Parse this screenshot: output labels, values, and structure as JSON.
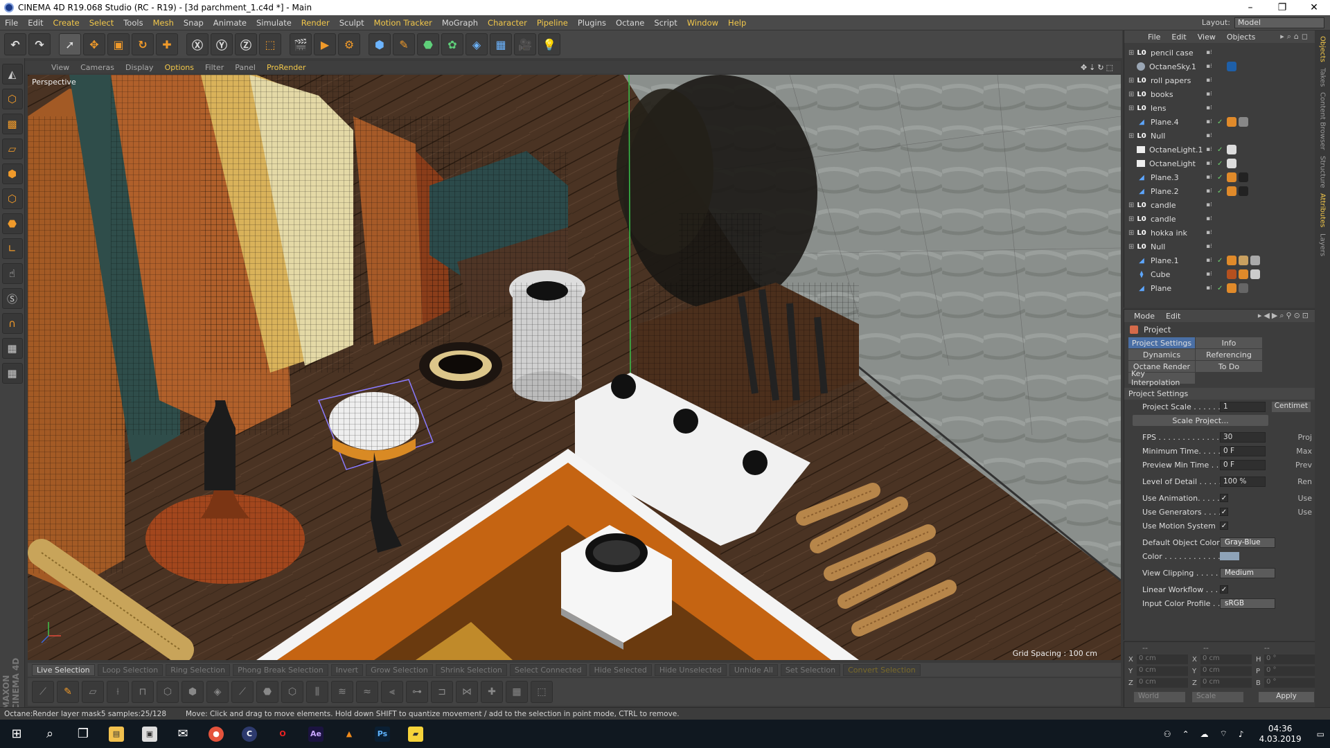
{
  "window": {
    "title": "CINEMA 4D R19.068 Studio (RC - R19) - [3d parchment_1.c4d *] - Main"
  },
  "menu": [
    "File",
    "Edit",
    "Create",
    "Select",
    "Tools",
    "Mesh",
    "Snap",
    "Animate",
    "Simulate",
    "Render",
    "Sculpt",
    "Motion Tracker",
    "MoGraph",
    "Character",
    "Pipeline",
    "Plugins",
    "Octane",
    "Script",
    "Window",
    "Help"
  ],
  "layout": {
    "label": "Layout:",
    "value": "Model"
  },
  "viewport_menu": [
    "View",
    "Cameras",
    "Display",
    "Options",
    "Filter",
    "Panel",
    "ProRender"
  ],
  "viewport": {
    "label": "Perspective",
    "grid_info": "Grid Spacing : 100 cm"
  },
  "selection_bar": [
    "Live Selection",
    "Loop Selection",
    "Ring Selection",
    "Phong Break Selection",
    "Invert",
    "Grow Selection",
    "Shrink Selection",
    "Select Connected",
    "Hide Selected",
    "Hide Unselected",
    "Unhide All",
    "Set Selection",
    "Convert Selection"
  ],
  "status": {
    "left": "Octane:Render layer mask5 samples:25/128",
    "right": "Move: Click and drag to move elements. Hold down SHIFT to quantize movement / add to the selection in point mode, CTRL to remove."
  },
  "objects_menu": [
    "File",
    "Edit",
    "View",
    "Objects"
  ],
  "objects": [
    {
      "name": "pencil case",
      "type": "null"
    },
    {
      "name": "OctaneSky.1",
      "type": "sky"
    },
    {
      "name": "roll papers",
      "type": "null"
    },
    {
      "name": "books",
      "type": "null"
    },
    {
      "name": "lens",
      "type": "null"
    },
    {
      "name": "Plane.4",
      "type": "plane"
    },
    {
      "name": "Null",
      "type": "null"
    },
    {
      "name": "OctaneLight.1",
      "type": "light"
    },
    {
      "name": "OctaneLight",
      "type": "light"
    },
    {
      "name": "Plane.3",
      "type": "plane"
    },
    {
      "name": "Plane.2",
      "type": "plane"
    },
    {
      "name": "candle",
      "type": "null"
    },
    {
      "name": "candle",
      "type": "null"
    },
    {
      "name": "hokka ink",
      "type": "null"
    },
    {
      "name": "Null",
      "type": "null"
    },
    {
      "name": "Plane.1",
      "type": "plane"
    },
    {
      "name": "Cube",
      "type": "cube"
    },
    {
      "name": "Plane",
      "type": "plane"
    }
  ],
  "attributes_menu": [
    "Mode",
    "Edit"
  ],
  "attributes": {
    "title": "Project",
    "tabs": [
      "Project Settings",
      "Info",
      "Dynamics",
      "Referencing",
      "Octane Render",
      "To Do",
      "Key Interpolation"
    ],
    "section": "Project Settings",
    "project_scale": {
      "label": "Project Scale . . . . . .",
      "value": "1",
      "unit": "Centimet"
    },
    "scale_button": "Scale Project...",
    "fps": {
      "label": "FPS . . . . . . . . . . . . . .",
      "value": "30",
      "extra": "Proj"
    },
    "min_time": {
      "label": "Minimum Time. . . . . .",
      "value": "0 F",
      "extra": "Max"
    },
    "preview_min": {
      "label": "Preview Min Time . . .",
      "value": "0 F",
      "extra": "Prev"
    },
    "lod": {
      "label": "Level of Detail . . . . .",
      "value": "100 %",
      "extra": "Ren"
    },
    "use_animation": {
      "label": "Use Animation. . . . . .",
      "extra": "Use"
    },
    "use_generators": {
      "label": "Use Generators . . . . .",
      "extra": "Use"
    },
    "use_motion": {
      "label": "Use Motion System"
    },
    "default_color": {
      "label": "Default Object Color",
      "value": "Gray-Blue"
    },
    "color": {
      "label": "Color . . . . . . . . . . . ."
    },
    "view_clipping": {
      "label": "View Clipping . . . . . .",
      "value": "Medium"
    },
    "linear_workflow": {
      "label": "Linear Workflow . . . ."
    },
    "input_color_profile": {
      "label": "Input Color Profile . .",
      "value": "sRGB"
    }
  },
  "coords": {
    "rows": [
      [
        "X",
        "0 cm",
        "X",
        "0 cm",
        "H",
        "0 °"
      ],
      [
        "Y",
        "0 cm",
        "Y",
        "0 cm",
        "P",
        "0 °"
      ],
      [
        "Z",
        "0 cm",
        "Z",
        "0 cm",
        "B",
        "0 °"
      ]
    ],
    "mode1": "World",
    "mode2": "Scale",
    "apply": "Apply"
  },
  "side_tabs": [
    "Objects",
    "Takes",
    "Content Browser",
    "Structure",
    "Attributes",
    "Layers"
  ],
  "clock": {
    "time": "04:36",
    "date": "4.03.2019"
  }
}
